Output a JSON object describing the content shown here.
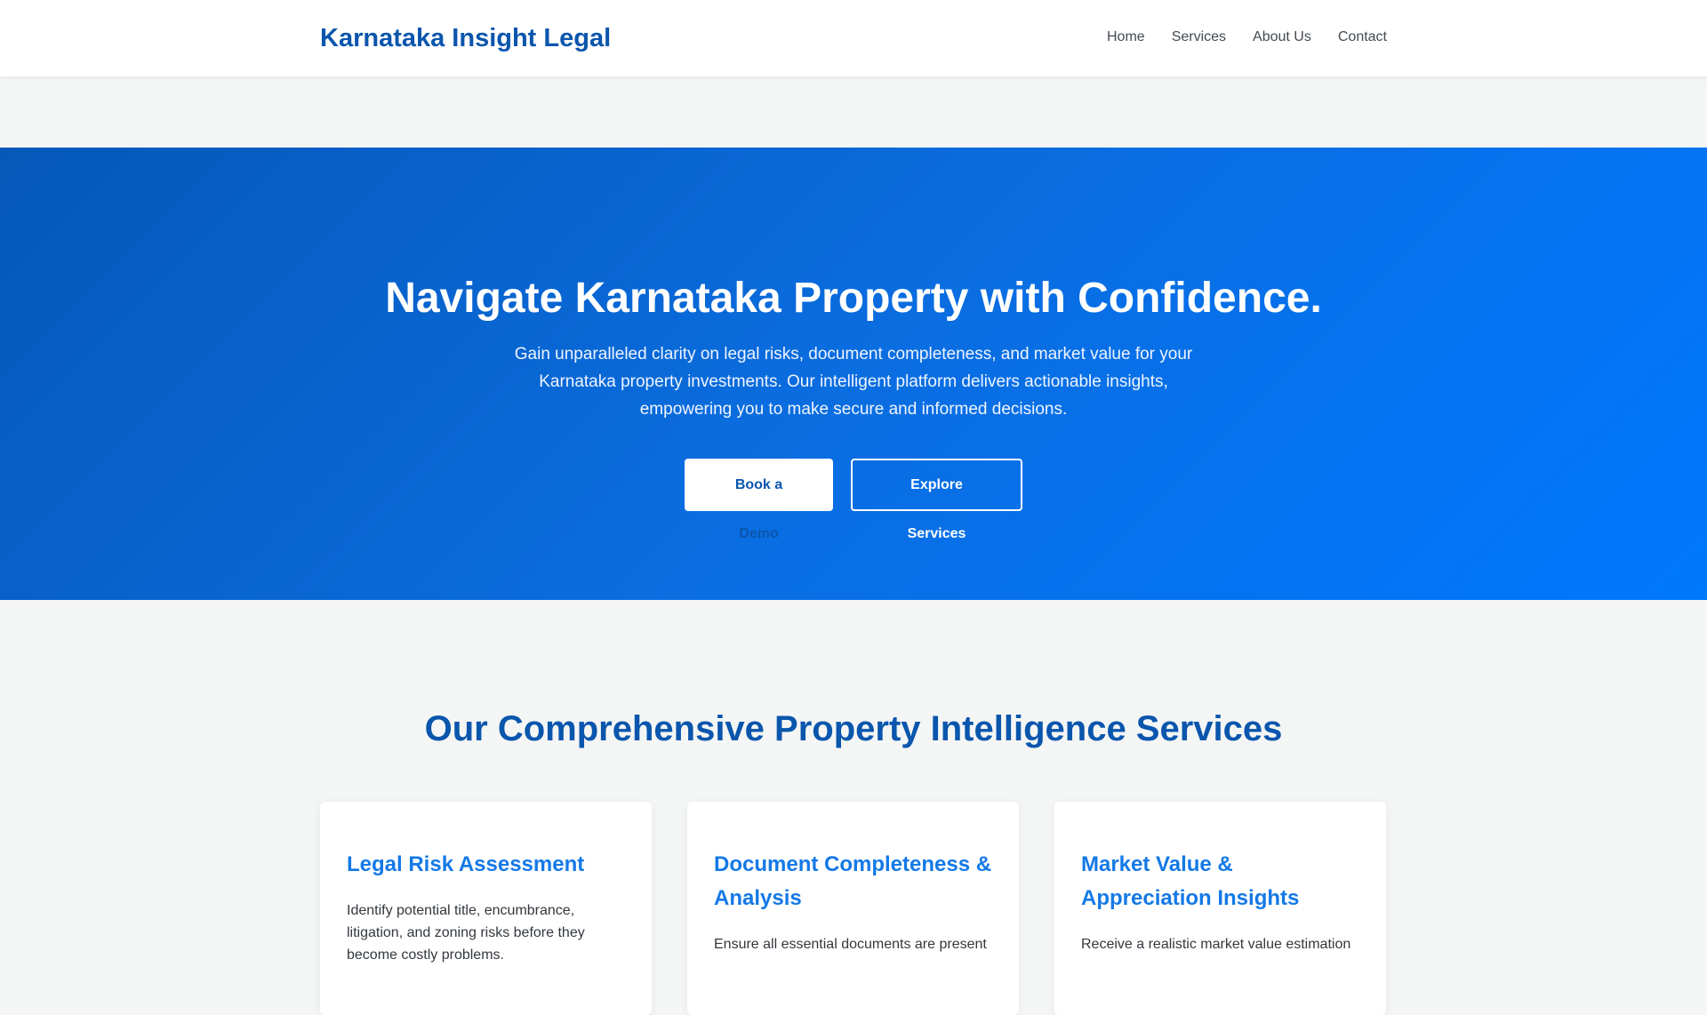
{
  "header": {
    "brand": "Karnataka Insight Legal",
    "nav": [
      {
        "label": "Home"
      },
      {
        "label": "Services"
      },
      {
        "label": "About Us"
      },
      {
        "label": "Contact"
      }
    ]
  },
  "hero": {
    "title": "Navigate Karnataka Property with Confidence.",
    "text": "Gain unparalleled clarity on legal risks, document completeness, and market value for your Karnataka property investments. Our intelligent platform delivers actionable insights, empowering you to make secure and informed decisions.",
    "primary_button": "Book a Demo",
    "secondary_button": "Explore Services"
  },
  "services": {
    "title": "Our Comprehensive Property Intelligence Services",
    "cards": [
      {
        "title": "Legal Risk Assessment",
        "text": "Identify potential title, encumbrance, litigation, and zoning risks before they become costly problems."
      },
      {
        "title": "Document Completeness & Analysis",
        "text": "Ensure all essential documents are present"
      },
      {
        "title": "Market Value & Appreciation Insights",
        "text": "Receive a realistic market value estimation"
      }
    ]
  },
  "colors": {
    "brand": "#0a56ad",
    "accent": "#1479e6",
    "hero_start": "#0658b8",
    "hero_end": "#0078ff",
    "background": "#f4f6f5"
  }
}
